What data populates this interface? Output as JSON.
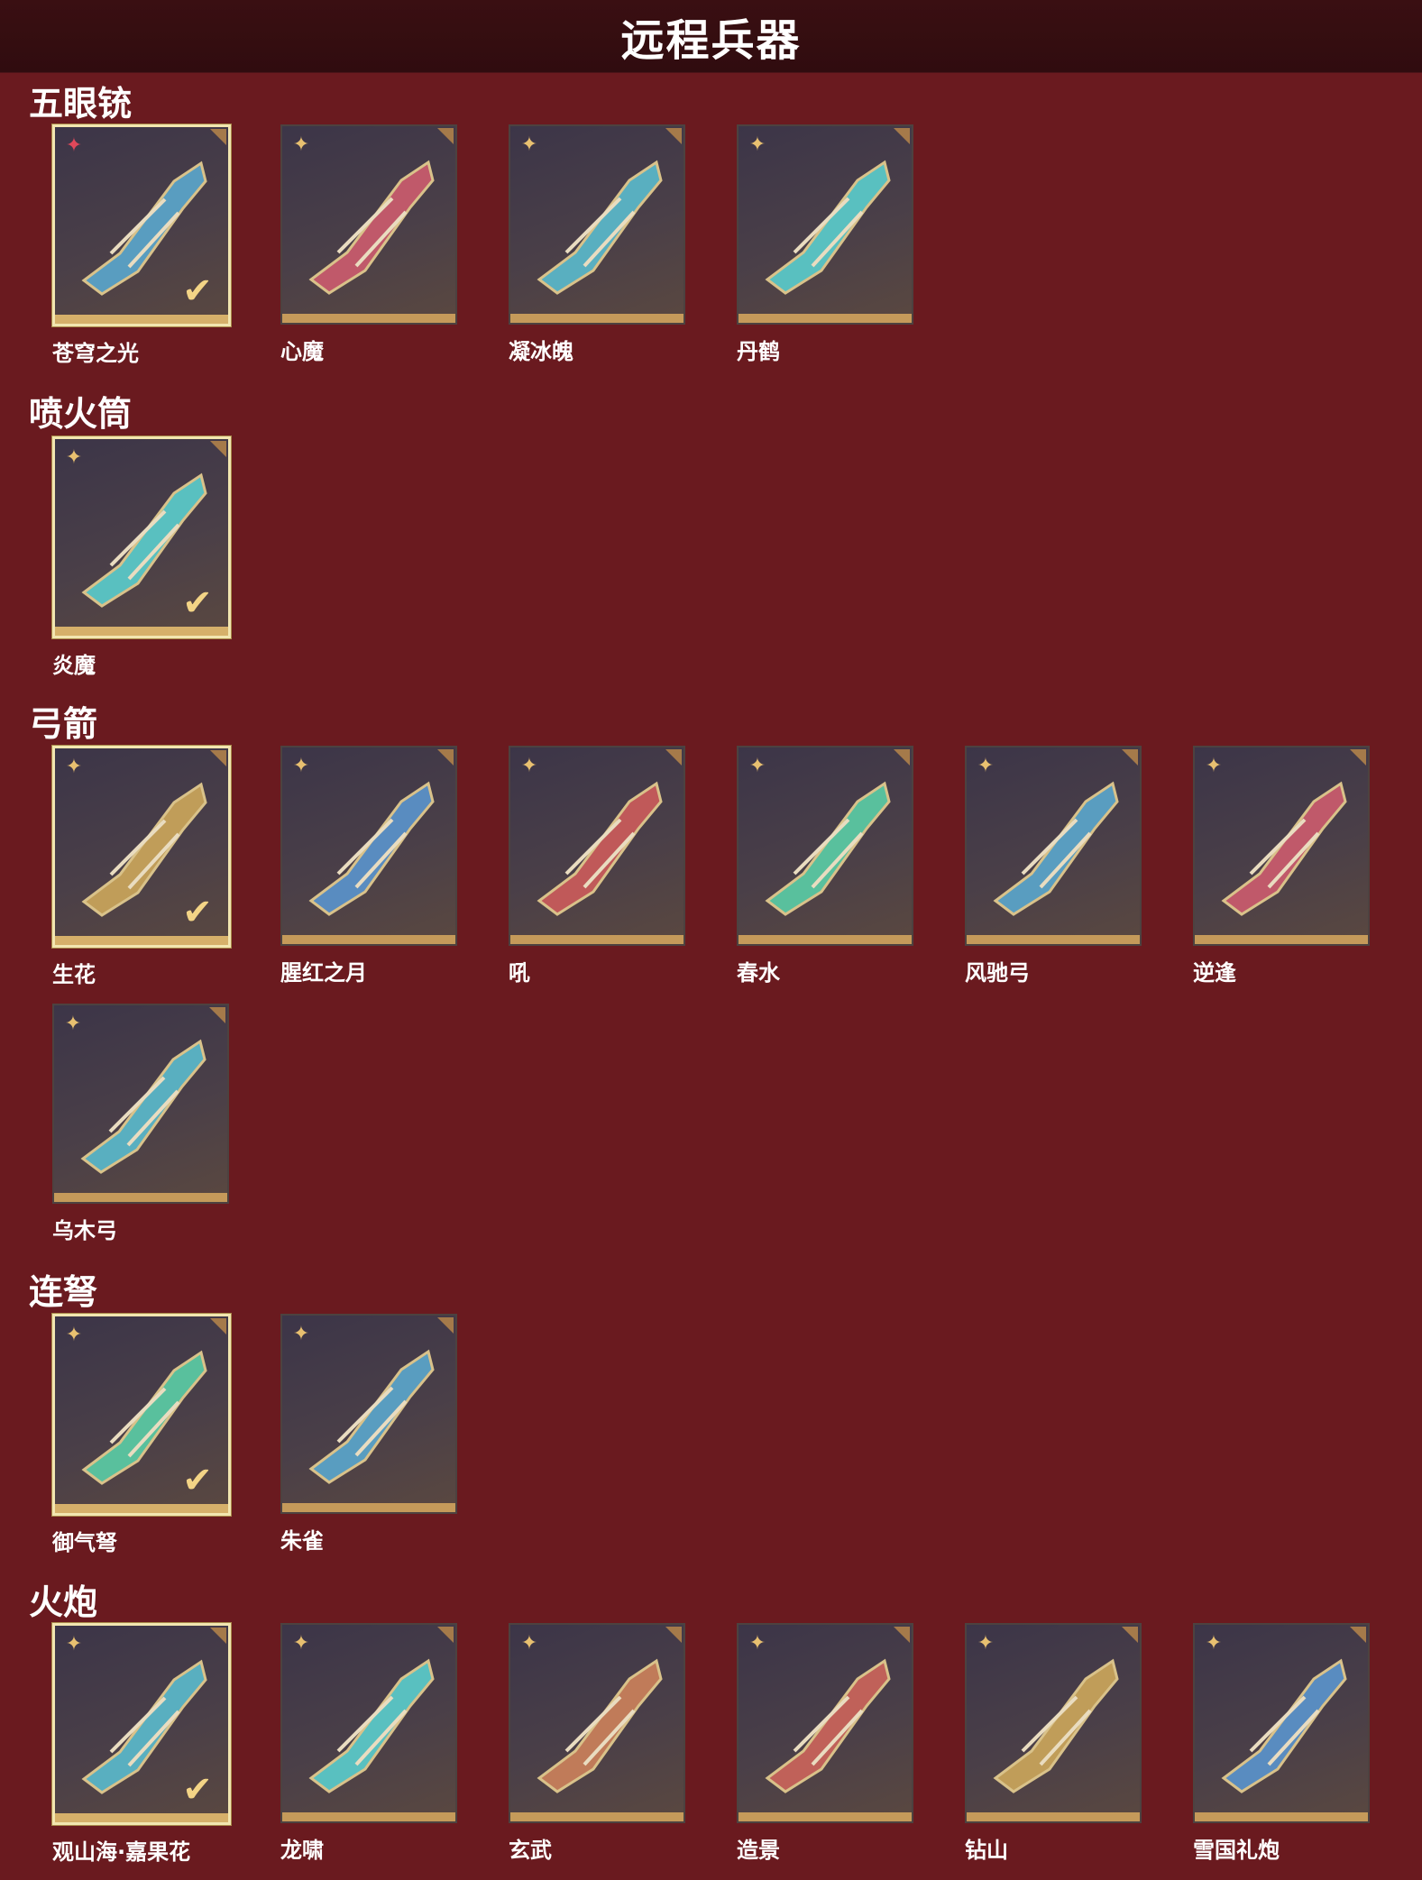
{
  "page": {
    "title": "远程兵器"
  },
  "sections": [
    {
      "title": "五眼铳",
      "items": [
        {
          "name": "苍穹之光",
          "selected": true,
          "rarity_icon": "star-flower-icon-red"
        },
        {
          "name": "心魔",
          "selected": false,
          "rarity_icon": "star-flower-icon-gold"
        },
        {
          "name": "凝冰魄",
          "selected": false,
          "rarity_icon": "star-flower-icon-gold"
        },
        {
          "name": "丹鹤",
          "selected": false,
          "rarity_icon": "star-flower-icon-gold"
        }
      ]
    },
    {
      "title": "喷火筒",
      "items": [
        {
          "name": "炎魔",
          "selected": true,
          "rarity_icon": "star-flower-icon-gold"
        }
      ]
    },
    {
      "title": "弓箭",
      "items": [
        {
          "name": "生花",
          "selected": true,
          "rarity_icon": "star-flower-icon-gold"
        },
        {
          "name": "腥红之月",
          "selected": false,
          "rarity_icon": "star-flower-icon-gold"
        },
        {
          "name": "吼",
          "selected": false,
          "rarity_icon": "star-flower-icon-gold"
        },
        {
          "name": "春水",
          "selected": false,
          "rarity_icon": "star-flower-icon-gold"
        },
        {
          "name": "风驰弓",
          "selected": false,
          "rarity_icon": "star-flower-icon-gold"
        },
        {
          "name": "逆逢",
          "selected": false,
          "rarity_icon": "star-flower-icon-gold"
        },
        {
          "name": "乌木弓",
          "selected": false,
          "rarity_icon": "star-flower-icon-gold"
        }
      ]
    },
    {
      "title": "连弩",
      "items": [
        {
          "name": "御气弩",
          "selected": true,
          "rarity_icon": "star-flower-icon-gold"
        },
        {
          "name": "朱雀",
          "selected": false,
          "rarity_icon": "star-flower-icon-gold"
        }
      ]
    },
    {
      "title": "火炮",
      "items": [
        {
          "name": "观山海·嘉果花",
          "selected": true,
          "rarity_icon": "star-flower-icon-gold"
        },
        {
          "name": "龙啸",
          "selected": false,
          "rarity_icon": "star-flower-icon-gold"
        },
        {
          "name": "玄武",
          "selected": false,
          "rarity_icon": "star-flower-icon-gold"
        },
        {
          "name": "造景",
          "selected": false,
          "rarity_icon": "star-flower-icon-gold"
        },
        {
          "name": "钻山",
          "selected": false,
          "rarity_icon": "star-flower-icon-gold"
        },
        {
          "name": "雪国礼炮",
          "selected": false,
          "rarity_icon": "star-flower-icon-gold"
        }
      ]
    }
  ],
  "colors": {
    "background": "#6a1a1f",
    "header": "#300c0f",
    "accent": "#c59a5a"
  }
}
